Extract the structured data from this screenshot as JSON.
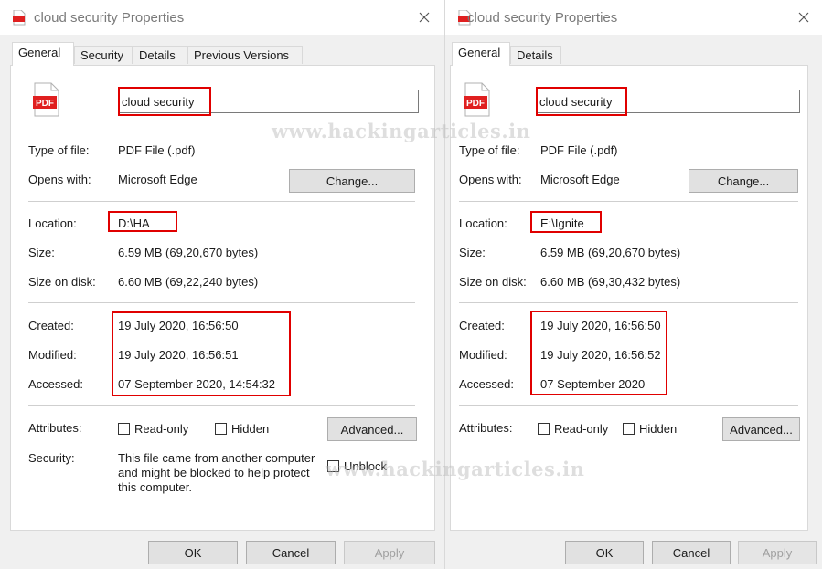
{
  "watermark": "www.hackingarticles.in",
  "colors": {
    "highlight": "#e00000",
    "pdf_red": "#e02020",
    "dialog_bg": "#f0f0f0"
  },
  "left": {
    "title": "cloud security Properties",
    "tabs": [
      {
        "label": "General"
      },
      {
        "label": "Security"
      },
      {
        "label": "Details"
      },
      {
        "label": "Previous Versions"
      }
    ],
    "pdf_badge": "PDF",
    "file_name": "cloud security",
    "type_label": "Type of file:",
    "type_value": "PDF File (.pdf)",
    "opens_label": "Opens with:",
    "opens_value": "Microsoft Edge",
    "change_button": "Change...",
    "location_label": "Location:",
    "location_value": "D:\\HA",
    "size_label": "Size:",
    "size_value": "6.59 MB (69,20,670 bytes)",
    "disk_label": "Size on disk:",
    "disk_value": "6.60 MB (69,22,240 bytes)",
    "created_label": "Created:",
    "created_value": "19 July 2020, 16:56:50",
    "modified_label": "Modified:",
    "modified_value": "19 July 2020, 16:56:51",
    "accessed_label": "Accessed:",
    "accessed_value": "07 September 2020, 14:54:32",
    "attributes_label": "Attributes:",
    "readonly_label": "Read-only",
    "hidden_label": "Hidden",
    "advanced_button": "Advanced...",
    "security_label": "Security:",
    "security_text_1": "This file came from another computer",
    "security_text_2": "and might be blocked to help protect",
    "security_text_3": "this computer.",
    "unblock_label": "Unblock",
    "ok_button": "OK",
    "cancel_button": "Cancel",
    "apply_button": "Apply"
  },
  "right": {
    "title": "cloud security Properties",
    "tabs": [
      {
        "label": "General"
      },
      {
        "label": "Details"
      }
    ],
    "pdf_badge": "PDF",
    "file_name": "cloud security",
    "type_label": "Type of file:",
    "type_value": "PDF File (.pdf)",
    "opens_label": "Opens with:",
    "opens_value": "Microsoft Edge",
    "change_button": "Change...",
    "location_label": "Location:",
    "location_value": "E:\\Ignite",
    "size_label": "Size:",
    "size_value": "6.59 MB (69,20,670 bytes)",
    "disk_label": "Size on disk:",
    "disk_value": "6.60 MB (69,30,432 bytes)",
    "created_label": "Created:",
    "created_value": "19 July 2020, 16:56:50",
    "modified_label": "Modified:",
    "modified_value": "19 July 2020, 16:56:52",
    "accessed_label": "Accessed:",
    "accessed_value": "07 September 2020",
    "attributes_label": "Attributes:",
    "readonly_label": "Read-only",
    "hidden_label": "Hidden",
    "advanced_button": "Advanced...",
    "ok_button": "OK",
    "cancel_button": "Cancel",
    "apply_button": "Apply"
  }
}
